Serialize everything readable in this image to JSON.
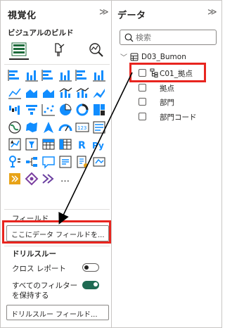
{
  "viz_pane": {
    "title": "視覚化",
    "collapse_glyph": "≫",
    "subtitle": "ビジュアルのビルド",
    "tab_icons": [
      "build-visual-icon",
      "format-visual-icon",
      "analytics-icon"
    ],
    "gallery_icons": [
      "stacked-bar-chart-icon",
      "stacked-column-chart-icon",
      "clustered-bar-chart-icon",
      "clustered-column-chart-icon",
      "100-stacked-bar-chart-icon",
      "100-stacked-column-chart-icon",
      "line-chart-icon",
      "area-chart-icon",
      "stacked-area-chart-icon",
      "line-and-stacked-column-chart-icon",
      "line-and-clustered-column-chart-icon",
      "ribbon-chart-icon",
      "waterfall-chart-icon",
      "funnel-chart-icon",
      "scatter-chart-icon",
      "pie-chart-icon",
      "donut-chart-icon",
      "treemap-icon",
      "map-icon",
      "filled-map-icon",
      "azure-map-icon",
      "gauge-icon",
      "card-icon",
      "multi-row-card-icon",
      "kpi-icon",
      "slicer-icon",
      "table-icon",
      "matrix-icon",
      "r-script-visual-icon",
      "python-visual-icon",
      "key-influencers-icon",
      "decomposition-tree-icon",
      "qa-icon",
      "smart-narrative-icon",
      "paginated-report-icon",
      "power-apps-icon",
      "power-automate-icon",
      "shape-map-icon",
      "new-card-icon",
      "more-visuals-icon"
    ],
    "fields_label": "フィールド",
    "fields_placeholder": "ここにデータ フィールドを...",
    "drillthrough_label": "ドリルスルー",
    "cross_report_label": "クロス レポート",
    "cross_report_state": "off",
    "keep_filters_label_1": "すべてのフィルター",
    "keep_filters_label_2": "を保持する",
    "keep_filters_state": "on",
    "drillthrough_fields_placeholder": "ドリルスルー フィールド...",
    "accent_color": "#118dff",
    "toggle_on_color": "#1e6a52"
  },
  "data_pane": {
    "title": "データ",
    "collapse_glyph": "≫",
    "search_placeholder": "検索",
    "table": {
      "chevron": "﹀",
      "icon": "table-icon",
      "name": "D03_Bumon"
    },
    "fields": [
      {
        "label": "C01_拠点",
        "icon": "hierarchy-icon"
      },
      {
        "label": "拠点",
        "icon": ""
      },
      {
        "label": "部門",
        "icon": ""
      },
      {
        "label": "部門コード",
        "icon": ""
      }
    ]
  },
  "annotation": {
    "highlight_color": "#e8251f",
    "arrow_color": "#000000"
  }
}
